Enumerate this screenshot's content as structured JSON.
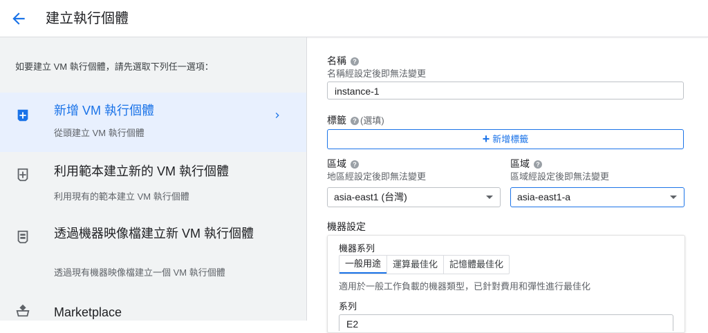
{
  "header": {
    "title": "建立執行個體"
  },
  "left": {
    "intro": "如要建立 VM 執行個體，請先選取下列任一選項：",
    "options": [
      {
        "title": "新增 VM 執行個體",
        "subtitle": "從頭建立 VM 執行個體"
      },
      {
        "title": "利用範本建立新的 VM 執行個體",
        "subtitle": "利用現有的範本建立 VM 執行個體"
      },
      {
        "title": "透過機器映像檔建立新 VM 執行個體",
        "subtitle": "透過現有機器映像檔建立一個 VM 執行個體"
      },
      {
        "title": "Marketplace",
        "subtitle": ""
      }
    ]
  },
  "form": {
    "name": {
      "label": "名稱",
      "sublabel": "名稱經設定後即無法變更",
      "value": "instance-1"
    },
    "labels": {
      "label": "標籤",
      "optional": "(選填)",
      "add_button": "新增標籤"
    },
    "region": {
      "label": "區域",
      "sublabel": "地區經設定後即無法變更",
      "value": "asia-east1 (台灣)"
    },
    "zone": {
      "label": "區域",
      "sublabel": "區域經設定後即無法變更",
      "value": "asia-east1-a"
    },
    "machine": {
      "label": "機器設定",
      "family_label": "機器系列",
      "tabs": [
        "一般用途",
        "運算最佳化",
        "記憶體最佳化"
      ],
      "description": "適用於一般工作負載的機器類型，已針對費用和彈性進行最佳化",
      "series_label": "系列",
      "series_value": "E2"
    }
  }
}
